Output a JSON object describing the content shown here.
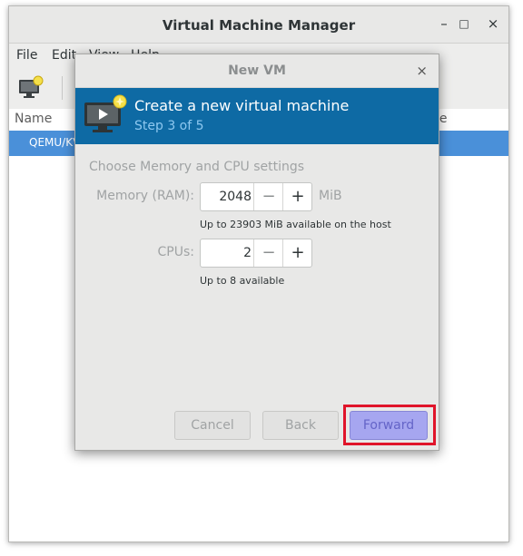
{
  "main": {
    "title": "Virtual Machine Manager",
    "window_buttons": {
      "minimize": "–",
      "maximize": "□",
      "close": "×"
    },
    "menu": [
      "File",
      "Edit",
      "View",
      "Help"
    ],
    "list": {
      "col_name": "Name",
      "col_usage": "ge",
      "row": "QEMU/KVM"
    }
  },
  "dialog": {
    "title": "New VM",
    "close": "×",
    "banner_title": "Create a new virtual machine",
    "banner_step": "Step 3 of 5",
    "section": "Choose Memory and CPU settings",
    "memory": {
      "label": "Memory (RAM):",
      "value": "2048",
      "unit": "MiB",
      "hint": "Up to 23903 MiB available on the host"
    },
    "cpus": {
      "label": "CPUs:",
      "value": "2",
      "hint": "Up to 8 available"
    },
    "buttons": {
      "cancel": "Cancel",
      "back": "Back",
      "forward": "Forward"
    }
  },
  "colors": {
    "banner": "#0e6aa4",
    "selection": "#4a90d9",
    "highlight": "#e0142a",
    "forward": "#a6a6f0"
  }
}
